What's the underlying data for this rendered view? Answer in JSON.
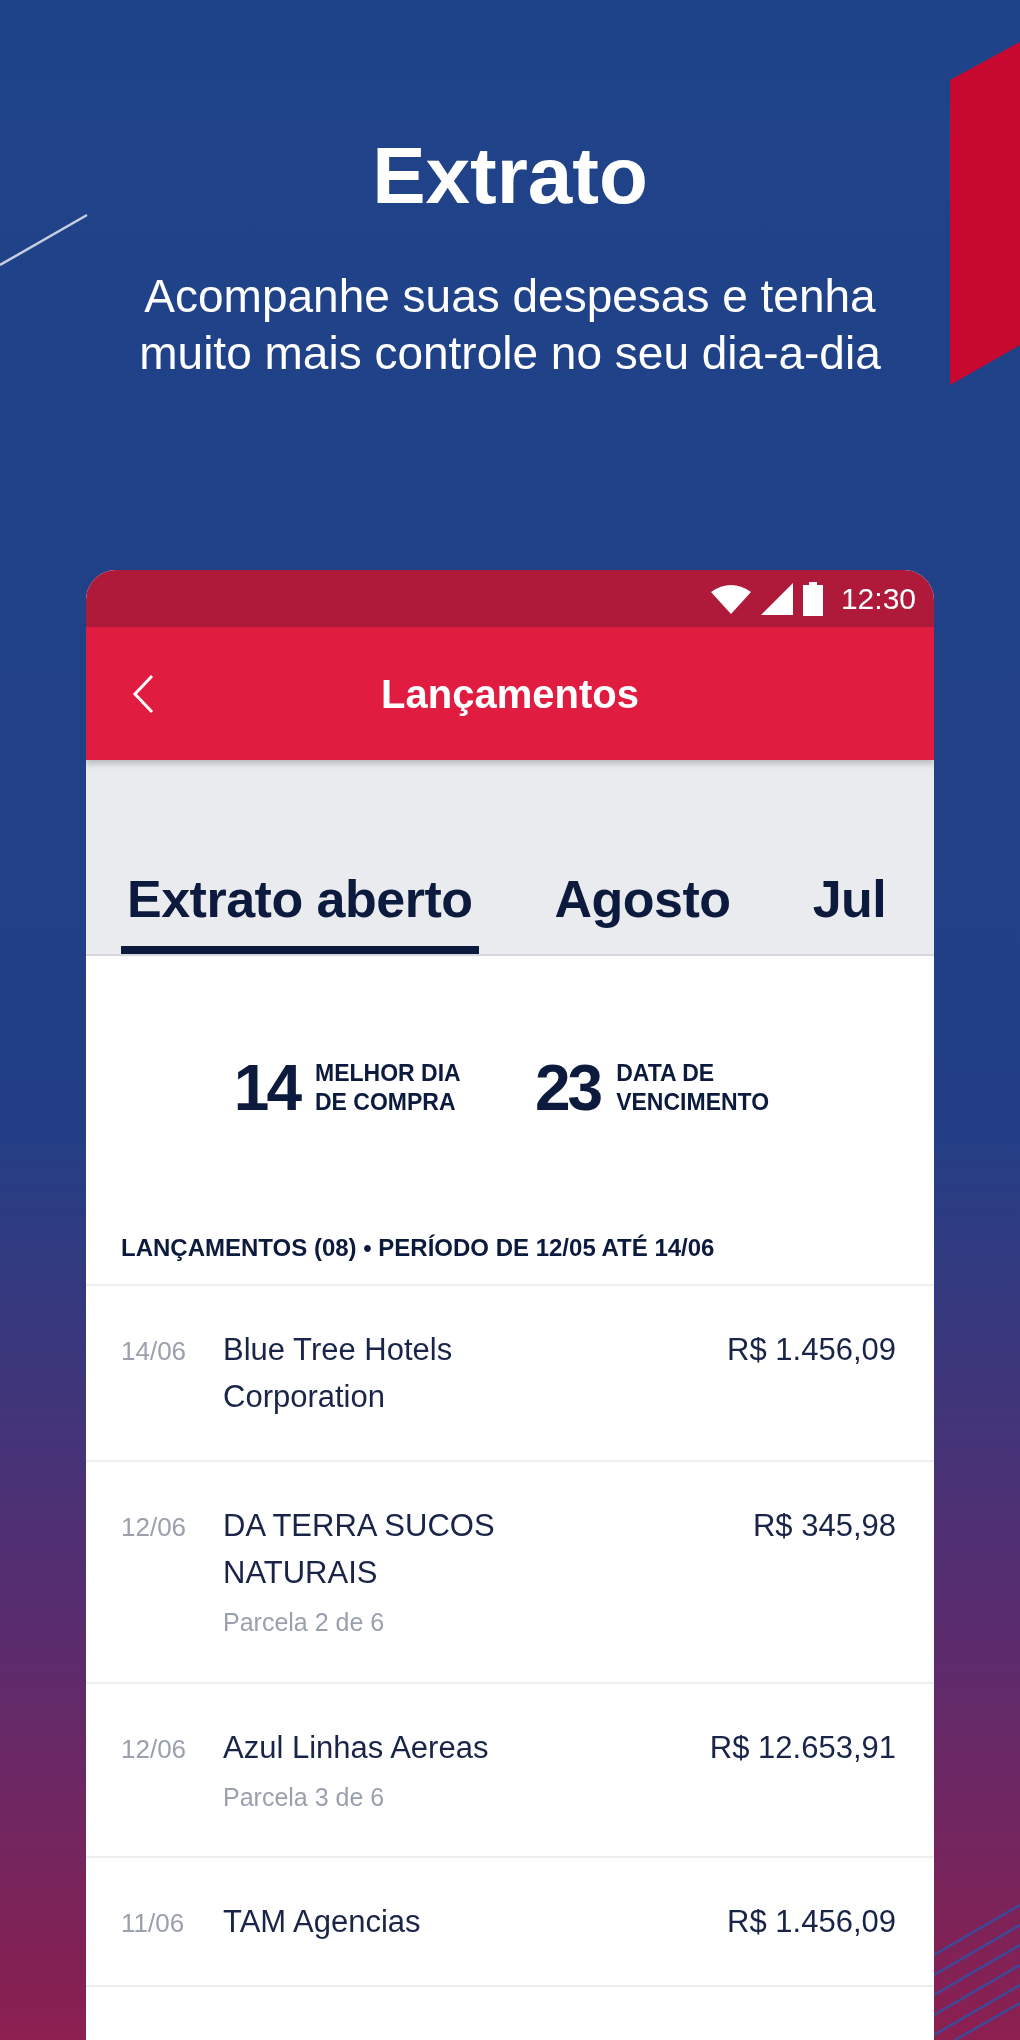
{
  "hero": {
    "title": "Extrato",
    "subtitle": "Acompanhe suas despesas e tenha muito mais controle no seu dia-a-dia"
  },
  "phone": {
    "status_bar": {
      "time": "12:30"
    },
    "toolbar": {
      "title": "Lançamentos"
    },
    "tabs": [
      {
        "label": "Extrato aberto",
        "selected": true
      },
      {
        "label": "Agosto",
        "selected": false
      },
      {
        "label": "Jul",
        "selected": false
      }
    ],
    "summary": [
      {
        "number": "14",
        "label": "MELHOR DIA DE COMPRA"
      },
      {
        "number": "23",
        "label": "DATA DE VENCIMENTO"
      }
    ],
    "list_header": "LANÇAMENTOS (08) • PERÍODO DE 12/05 ATÉ 14/06",
    "transactions": [
      {
        "date": "14/06",
        "description": "Blue Tree Hotels Corporation",
        "amount": "R$ 1.456,09"
      },
      {
        "date": "12/06",
        "description": "DA TERRA SUCOS NATURAIS",
        "installment": "Parcela 2 de 6",
        "amount": "R$ 345,98"
      },
      {
        "date": "12/06",
        "description": "Azul Linhas Aereas",
        "installment": "Parcela 3 de 6",
        "amount": "R$ 12.653,91"
      },
      {
        "date": "11/06",
        "description": "TAM Agencias",
        "amount": "R$ 1.456,09"
      }
    ]
  }
}
